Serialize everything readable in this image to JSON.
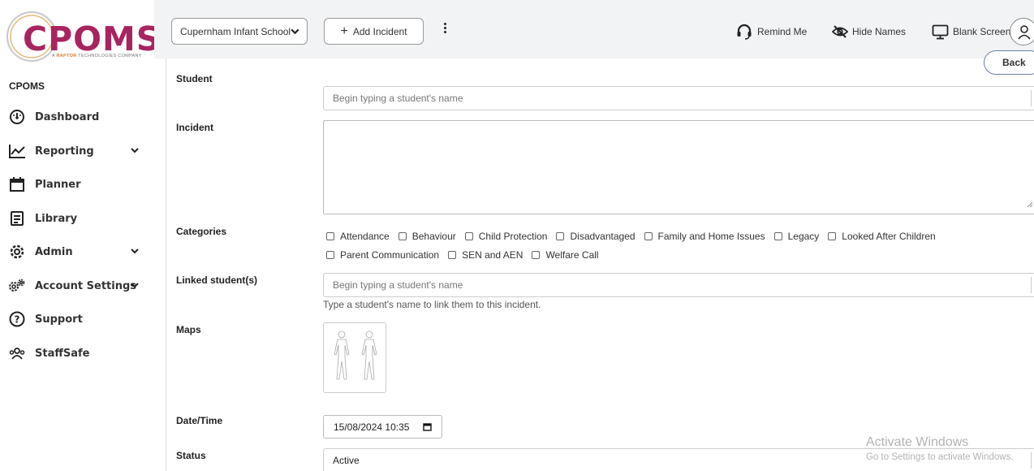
{
  "brand": {
    "logo_text": "CPOMS",
    "tagline_prefix": "A ",
    "tagline_brand": "RAPTOR",
    "tagline_suffix": " TECHNOLOGIES COMPANY",
    "color": "#a8245f"
  },
  "sidebar": {
    "heading": "CPOMS",
    "items": [
      {
        "label": "Dashboard",
        "icon": "dashboard-icon"
      },
      {
        "label": "Reporting",
        "icon": "chart-line-icon",
        "expandable": true
      },
      {
        "label": "Planner",
        "icon": "calendar-icon"
      },
      {
        "label": "Library",
        "icon": "library-icon"
      },
      {
        "label": "Admin",
        "icon": "gear-icon",
        "expandable": true
      },
      {
        "label": "Account Settings",
        "icon": "gears-icon",
        "expandable": true
      },
      {
        "label": "Support",
        "icon": "help-icon"
      },
      {
        "label": "StaffSafe",
        "icon": "users-icon"
      }
    ]
  },
  "topbar": {
    "school": "Cupernham Infant School",
    "add_incident": "Add Incident",
    "remind_me": "Remind Me",
    "hide_names": "Hide Names",
    "blank_screen": "Blank Screen"
  },
  "form": {
    "back_label": "Back",
    "student_label": "Student",
    "student_placeholder": "Begin typing a student's name",
    "incident_label": "Incident",
    "categories_label": "Categories",
    "categories": [
      "Attendance",
      "Behaviour",
      "Child Protection",
      "Disadvantaged",
      "Family and Home Issues",
      "Legacy",
      "Looked After Children",
      "Parent Communication",
      "SEN and AEN",
      "Welfare Call"
    ],
    "linked_label": "Linked student(s)",
    "linked_placeholder": "Begin typing a student's name",
    "linked_hint": "Type a student's name to link them to this incident.",
    "maps_label": "Maps",
    "datetime_label": "Date/Time",
    "datetime_value": "15/08/2024 10:35",
    "status_label": "Status",
    "status_value": "Active"
  },
  "watermark": {
    "title": "Activate Windows",
    "subtitle": "Go to Settings to activate Windows."
  }
}
